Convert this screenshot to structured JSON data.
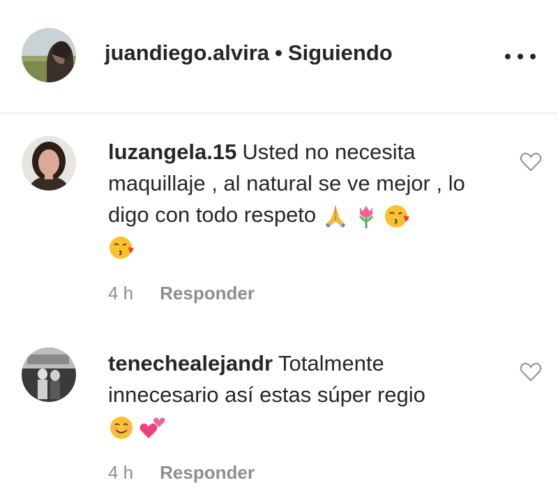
{
  "post_header": {
    "username": "juandiego.alvira",
    "separator": "•",
    "follow_status": "Siguiendo"
  },
  "comments": [
    {
      "username": "luzangela.15",
      "text": "Usted no necesita maquillaje , al natural se ve mejor , lo digo con todo respeto",
      "emojis": [
        "folded-hands-emoji",
        "tulip-emoji",
        "face-blowing-kiss-emoji",
        "face-blowing-kiss-emoji"
      ],
      "time": "4 h",
      "reply_label": "Responder"
    },
    {
      "username": "tenechealejandr",
      "text": "Totalmente innecesario así estas súper regio",
      "emojis": [
        "smiling-face-emoji",
        "two-hearts-emoji"
      ],
      "time": "4 h",
      "reply_label": "Responder"
    }
  ],
  "colors": {
    "text": "#262626",
    "meta_text": "#8e8e8e",
    "divider": "#efefef"
  }
}
